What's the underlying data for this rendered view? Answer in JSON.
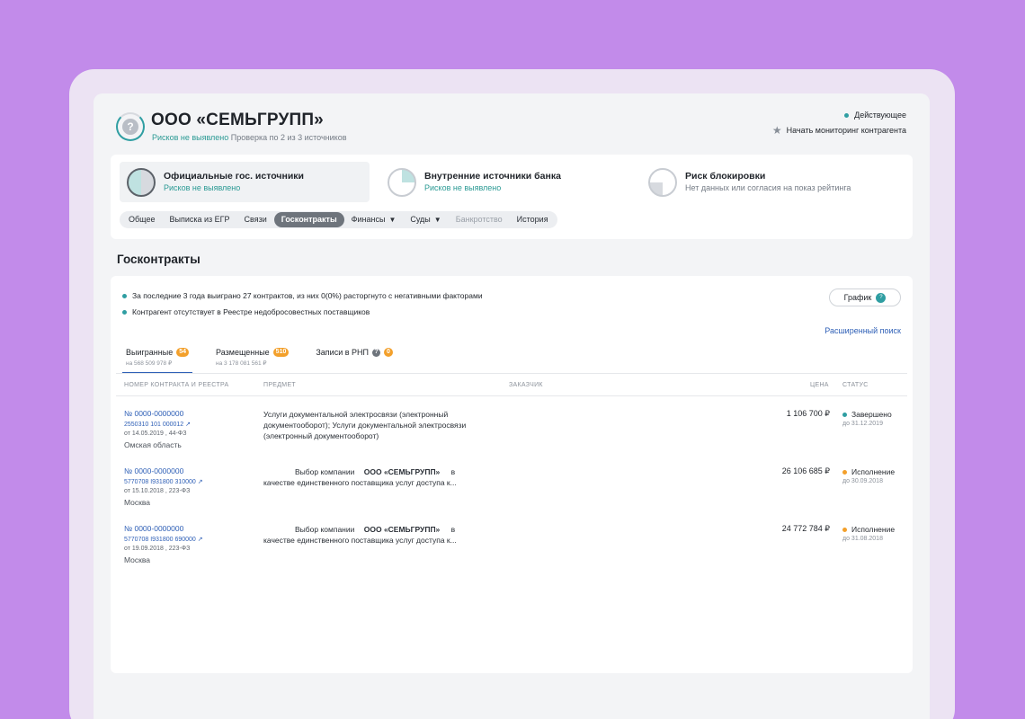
{
  "company": {
    "name": "ООО «СЕМЬГРУПП»",
    "risk_status": "Рисков не выявлено",
    "check_info": "Проверка по 2 из 3 источников",
    "state": "Действующее",
    "monitor_label": "Начать мониторинг контрагента"
  },
  "sources": [
    {
      "title": "Официальные гос. источники",
      "status": "Рисков не выявлено"
    },
    {
      "title": "Внутренние источники банка",
      "status": "Рисков не выявлено"
    },
    {
      "title": "Риск блокировки",
      "status": "Нет данных или согласия на показ рейтинга"
    }
  ],
  "tabs": [
    {
      "label": "Общее"
    },
    {
      "label": "Выписка из ЕГР"
    },
    {
      "label": "Связи"
    },
    {
      "label": "Госконтракты",
      "active": true
    },
    {
      "label": "Финансы",
      "dropdown": true
    },
    {
      "label": "Суды",
      "dropdown": true
    },
    {
      "label": "Банкротство",
      "disabled": true
    },
    {
      "label": "История"
    }
  ],
  "section_title": "Госконтракты",
  "info_lines": [
    "За последние 3 года выиграно 27 контрактов, из них 0(0%) расторгнуто с негативными факторами",
    "Контрагент отсутствует в Реестре недобросовестных поставщиков"
  ],
  "graph_button": {
    "label": "График",
    "badge": "?"
  },
  "advanced_search": "Расширенный поиск",
  "sub_tabs": [
    {
      "label": "Выигранные",
      "badge": "54",
      "sub": "на 568 509 978 ₽"
    },
    {
      "label": "Размещенные",
      "badge": "510",
      "sub": "на 3 178 081 561 ₽"
    },
    {
      "label": "Записи в РНП",
      "badge": "0",
      "sub": ""
    }
  ],
  "columns": {
    "number": "НОМЕР КОНТРАКТА И РЕЕСТРА",
    "subject": "ПРЕДМЕТ",
    "customer": "ЗАКАЗЧИК",
    "price": "ЦЕНА",
    "status": "СТАТУС"
  },
  "contracts": [
    {
      "number": "№ 0000-0000000",
      "registry": "2550310 101 000012",
      "date": "от 14.05.2019 , 44-ФЗ",
      "region": "Омская область",
      "subject": "Услуги документальной электросвязи (электронный документооборот); Услуги документальной электросвязи (электронный документооборот)",
      "price": "1 106 700 ₽",
      "status": "Завершено",
      "status_color": "#2f9ea2",
      "status_date": "до 31.12.2019"
    },
    {
      "number": "№ 0000-0000000",
      "registry": "5770708 I931800 310000",
      "date": "от 15.10.2018 , 223-ФЗ",
      "region": "Москва",
      "subject_pre": "Выбор компании",
      "subject_company": "ООО «СЕМЬГРУПП»",
      "subject_post": "в",
      "subject_line2": "качестве единственного поставщика услуг доступа к...",
      "price": "26 106 685 ₽",
      "status": "Исполнение",
      "status_color": "#f3a02b",
      "status_date": "до 30.09.2018"
    },
    {
      "number": "№ 0000-0000000",
      "registry": "5770708 I931800 690000",
      "date": "от 19.09.2018 , 223-ФЗ",
      "region": "Москва",
      "subject_pre": "Выбор компании",
      "subject_company": "ООО «СЕМЬГРУПП»",
      "subject_post": "в",
      "subject_line2": "качестве единственного поставщика услуг доступа к...",
      "price": "24 772 784 ₽",
      "status": "Исполнение",
      "status_color": "#f3a02b",
      "status_date": "до 31.08.2018"
    }
  ]
}
